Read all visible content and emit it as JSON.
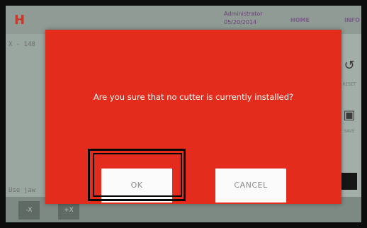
{
  "app": {
    "logo": "H",
    "user": "Administrator",
    "date": "05/20/2014",
    "nav": [
      "HOME",
      "INFO"
    ],
    "coord_text": "X - 148",
    "use_label": "Use jaw"
  },
  "side_panel": {
    "reset_label": "RESET",
    "save_label": "SAVE"
  },
  "bottom_bar": {
    "buttons": [
      "-X",
      "+X"
    ]
  },
  "dialog": {
    "message": "Are you sure that no cutter is currently installed?",
    "ok_label": "OK",
    "cancel_label": "CANCEL",
    "background_color": "#e32c1b"
  }
}
